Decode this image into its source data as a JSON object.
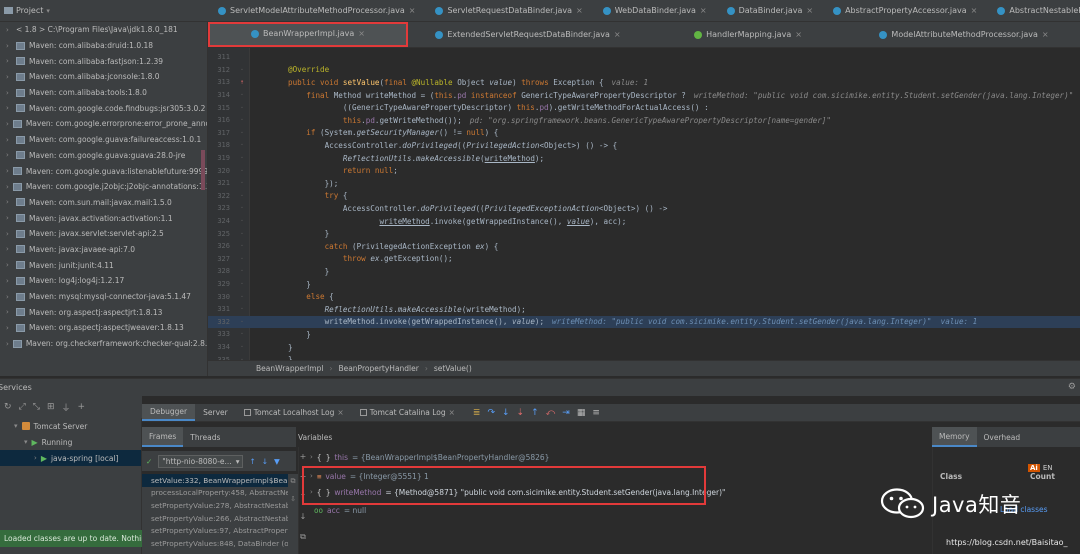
{
  "project_header": {
    "label": "Project"
  },
  "tabs_row1": [
    {
      "label": "ServletModelAttributeMethodProcessor.java",
      "kind": "class"
    },
    {
      "label": "ServletRequestDataBinder.java",
      "kind": "class"
    },
    {
      "label": "WebDataBinder.java",
      "kind": "class"
    },
    {
      "label": "DataBinder.java",
      "kind": "class"
    },
    {
      "label": "AbstractPropertyAccessor.java",
      "kind": "class"
    },
    {
      "label": "AbstractNestablePropertyAccessor.java",
      "kind": "class"
    }
  ],
  "tabs_row2": [
    {
      "label": "BeanWrapperImpl.java",
      "kind": "class",
      "active": true,
      "highlighted": true
    },
    {
      "label": "ExtendedServletRequestDataBinder.java",
      "kind": "class"
    },
    {
      "label": "HandlerMapping.java",
      "kind": "iface"
    },
    {
      "label": "ModelAttributeMethodProcessor.java",
      "kind": "class"
    }
  ],
  "project_tree": {
    "top_path": "< 1.8 > C:\\Program Files\\Java\\jdk1.8.0_181",
    "items": [
      "Maven: com.alibaba:druid:1.0.18",
      "Maven: com.alibaba:fastjson:1.2.39",
      "Maven: com.alibaba:jconsole:1.8.0",
      "Maven: com.alibaba:tools:1.8.0",
      "Maven: com.google.code.findbugs:jsr305:3.0.2",
      "Maven: com.google.errorprone:error_prone_annota",
      "Maven: com.google.guava:failureaccess:1.0.1",
      "Maven: com.google.guava:guava:28.0-jre",
      "Maven: com.google.guava:listenablefuture:9999.0-e",
      "Maven: com.google.j2objc:j2objc-annotations:1.3",
      "Maven: com.sun.mail:javax.mail:1.5.0",
      "Maven: javax.activation:activation:1.1",
      "Maven: javax.servlet:servlet-api:2.5",
      "Maven: javax:javaee-api:7.0",
      "Maven: junit:junit:4.11",
      "Maven: log4j:log4j:1.2.17",
      "Maven: mysql:mysql-connector-java:5.1.47",
      "Maven: org.aspectj:aspectjrt:1.8.13",
      "Maven: org.aspectj:aspectjweaver:1.8.13",
      "Maven: org.checkerframework:checker-qual:2.8.1"
    ]
  },
  "editor": {
    "lines": [
      {
        "n": "311",
        "text": ""
      },
      {
        "n": "312",
        "text": "@Override"
      },
      {
        "n": "313",
        "text": "public void setValue(final @Nullable Object value) throws Exception {",
        "inline": "value: 1",
        "mark": "override"
      },
      {
        "n": "314",
        "text": "    final Method writeMethod = (this.pd instanceof GenericTypeAwarePropertyDescriptor ?",
        "inline": "writeMethod: \"public void com.sicimike.entity.Student.setGender(java.lang.Integer)\""
      },
      {
        "n": "315",
        "text": "            ((GenericTypeAwarePropertyDescriptor) this.pd).getWriteMethodForActualAccess() :"
      },
      {
        "n": "316",
        "text": "            this.pd.getWriteMethod());",
        "inline": "pd: \"org.springframework.beans.GenericTypeAwarePropertyDescriptor[name=gender]\""
      },
      {
        "n": "317",
        "text": "    if (System.getSecurityManager() != null) {"
      },
      {
        "n": "318",
        "text": "        AccessController.doPrivileged((PrivilegedAction<Object>) () -> {"
      },
      {
        "n": "319",
        "text": "            ReflectionUtils.makeAccessible(writeMethod);"
      },
      {
        "n": "320",
        "text": "            return null;"
      },
      {
        "n": "321",
        "text": "        });"
      },
      {
        "n": "322",
        "text": "        try {"
      },
      {
        "n": "323",
        "text": "            AccessController.doPrivileged((PrivilegedExceptionAction<Object>) () ->"
      },
      {
        "n": "324",
        "text": "                    writeMethod.invoke(getWrappedInstance(), value), acc);"
      },
      {
        "n": "325",
        "text": "        }"
      },
      {
        "n": "326",
        "text": "        catch (PrivilegedActionException ex) {"
      },
      {
        "n": "327",
        "text": "            throw ex.getException();"
      },
      {
        "n": "328",
        "text": "        }"
      },
      {
        "n": "329",
        "text": "    }"
      },
      {
        "n": "330",
        "text": "    else {"
      },
      {
        "n": "331",
        "text": "        ReflectionUtils.makeAccessible(writeMethod);"
      },
      {
        "n": "332",
        "text": "        writeMethod.invoke(getWrappedInstance(), value);",
        "inline": "writeMethod: \"public void com.sicimike.entity.Student.setGender(java.lang.Integer)\"  value: 1",
        "exec": true
      },
      {
        "n": "333",
        "text": "    }"
      },
      {
        "n": "334",
        "text": "}"
      },
      {
        "n": "335",
        "text": "}"
      }
    ]
  },
  "breadcrumbs": [
    "BeanWrapperImpl",
    "BeanPropertyHandler",
    "setValue()"
  ],
  "services": {
    "title": "Services",
    "tree": [
      {
        "label": "Tomcat Server",
        "level": 1
      },
      {
        "label": "Running",
        "level": 2
      },
      {
        "label": "java-spring [local]",
        "level": 3
      }
    ],
    "reload_note": "Loaded classes are up to date. Nothing to reload."
  },
  "debugger": {
    "tabs": [
      "Debugger",
      "Server",
      "Tomcat Localhost Log",
      "Tomcat Catalina Log"
    ],
    "frames_tab": "Frames",
    "threads_tab": "Threads",
    "thread": "\"http-nio-8080-e...",
    "frames": [
      "setValue:332, BeanWrapperImpl$BeanP",
      "processLocalProperty:458, AbstractNest",
      "setPropertyValue:278, AbstractNestable",
      "setPropertyValue:266, AbstractNestable",
      "setPropertyValues:97, AbstractPropertyA",
      "setPropertyValues:848, DataBinder (org"
    ],
    "variables_title": "Variables",
    "variables": [
      {
        "icon": "{ }",
        "name": "this",
        "value": "= {BeanWrapperImpl$BeanPropertyHandler@5826}"
      },
      {
        "icon": "≡",
        "name": "value",
        "value": "= {Integer@5551} 1"
      },
      {
        "icon": "{ }",
        "name": "writeMethod",
        "value": "= {Method@5871} \"public void com.sicimike.entity.Student.setGender(java.lang.Integer)\""
      },
      {
        "icon": "oo",
        "name": "acc",
        "value": "= null"
      }
    ]
  },
  "memory": {
    "tabs": [
      "Memory",
      "Overhead"
    ],
    "class_col": "Class",
    "count_col": "Count",
    "load_text": "Load classes",
    "ime_ai": "Ai",
    "ime_en": "EN"
  },
  "watermark": {
    "name": "Java知音",
    "url": "https://blog.csdn.net/Baisitao_"
  }
}
